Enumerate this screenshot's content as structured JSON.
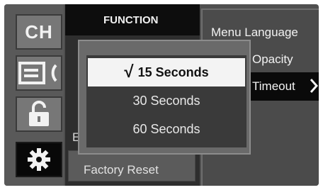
{
  "sidebar": {
    "items": [
      {
        "label": "CH",
        "icon": "channel-icon"
      },
      {
        "label": "",
        "icon": "input-source-icon"
      },
      {
        "label": "",
        "icon": "lock-icon"
      },
      {
        "label": "",
        "icon": "gear-icon"
      }
    ]
  },
  "function_panel": {
    "title": "FUNCTION",
    "items": [
      {
        "label": "E"
      },
      {
        "label": "Factory Reset"
      }
    ]
  },
  "menu": {
    "items": [
      {
        "label": "Menu Language"
      },
      {
        "label": "Opacity"
      },
      {
        "label": "Timeout",
        "has_submenu": true
      }
    ]
  },
  "popup": {
    "options": [
      {
        "label": "15 Seconds",
        "selected": true,
        "check": "√"
      },
      {
        "label": "30 Seconds",
        "selected": false
      },
      {
        "label": "60 Seconds",
        "selected": false
      }
    ]
  },
  "colors": {
    "screen_bg": "#4f4f4f",
    "active_item_bg": "#080808",
    "selected_option_bg": "#f3f3f3",
    "text": "#f2f2f2"
  }
}
